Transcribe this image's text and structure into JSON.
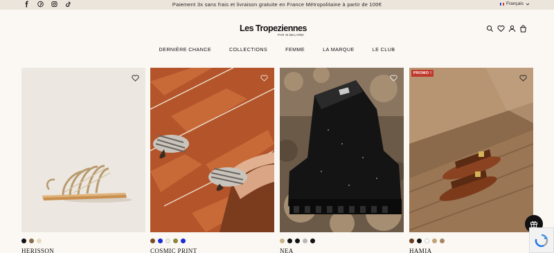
{
  "topbar": {
    "promo": "Paiement 3x sans frais et livraison gratuite en France Métropolitaine à partir de 100€",
    "language": "Français",
    "socials": [
      "facebook-icon",
      "pinterest-icon",
      "instagram-icon",
      "tiktok-icon"
    ]
  },
  "header": {
    "logo": "Les Tropeziennes",
    "logo_sub": "PAR M.BELARBI",
    "icons": [
      "search-icon",
      "heart-icon",
      "user-icon",
      "bag-icon"
    ]
  },
  "nav": {
    "items": [
      "DERNIÈRE CHANCE",
      "COLLECTIONS",
      "FEMME",
      "LA MARQUE",
      "LE CLUB"
    ]
  },
  "products": [
    {
      "name": "HERISSON",
      "badge": "",
      "swatches": [
        "#111111",
        "#8a6b4e",
        "#e8d9c0"
      ]
    },
    {
      "name": "COSMIC PRINT",
      "badge": "",
      "swatches": [
        "#7a4a22",
        "#1b2bd6",
        "#f0ece4",
        "#8a8a3a",
        "#1b2bd6"
      ]
    },
    {
      "name": "NEA",
      "badge": "",
      "swatches": [
        "#c8b48a",
        "#111111",
        "#111111",
        "#b8b8b8",
        "#111111"
      ]
    },
    {
      "name": "HAMIA",
      "badge": "PROMO !",
      "swatches": [
        "#6b3a1f",
        "#111111",
        "#ffffff",
        "#c2a27a",
        "#a98660"
      ]
    }
  ],
  "colors": {
    "accent_badge": "#c0392b",
    "topbar_bg": "#ece5dc",
    "page_bg": "#fbf8f4"
  }
}
